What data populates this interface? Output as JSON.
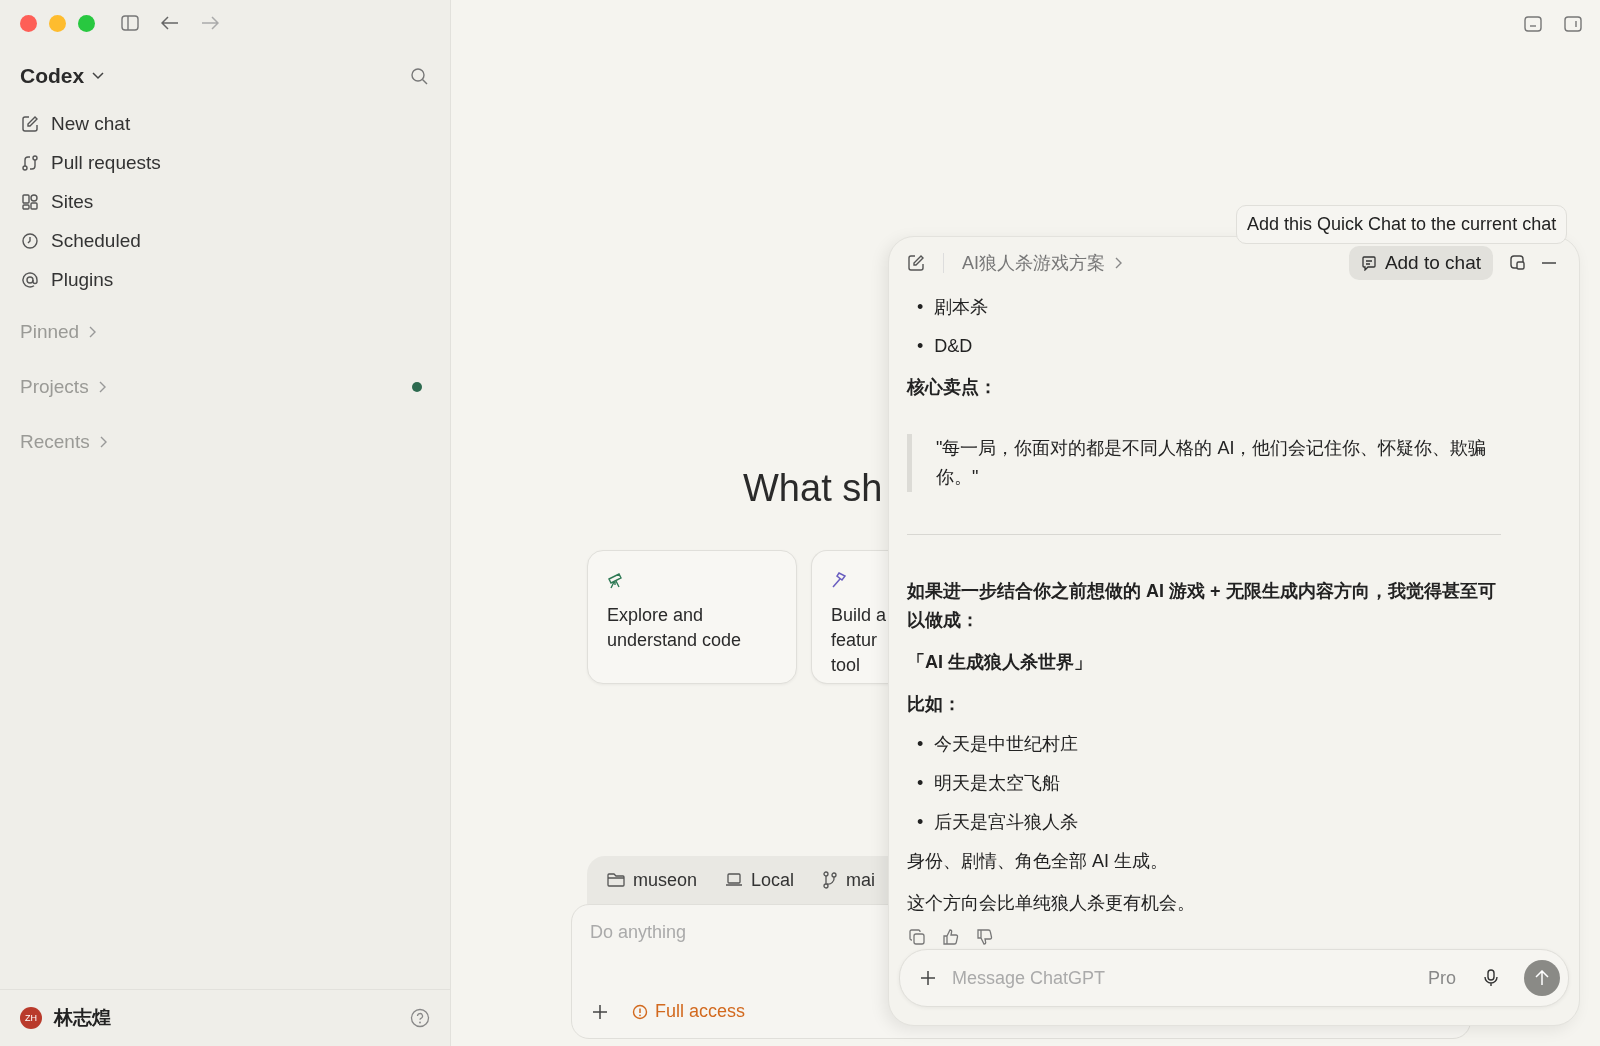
{
  "sidebar": {
    "workspace": "Codex",
    "nav": [
      {
        "label": "New chat"
      },
      {
        "label": "Pull requests"
      },
      {
        "label": "Sites"
      },
      {
        "label": "Scheduled"
      },
      {
        "label": "Plugins"
      }
    ],
    "sections": [
      {
        "label": "Pinned",
        "indicator": false
      },
      {
        "label": "Projects",
        "indicator": true
      },
      {
        "label": "Recents",
        "indicator": false
      }
    ],
    "user": {
      "initials": "ZH",
      "name": "林志煌"
    }
  },
  "main": {
    "heading": "What sh",
    "cards": [
      {
        "lines": [
          "Explore and",
          "understand code"
        ]
      },
      {
        "lines": [
          "Build a",
          "featur",
          "tool"
        ]
      }
    ],
    "context": [
      {
        "label": "museon"
      },
      {
        "label": "Local"
      },
      {
        "label": "mai"
      }
    ],
    "composer": {
      "placeholder": "Do anything",
      "access": "Full access"
    }
  },
  "quick_chat": {
    "tooltip": "Add this Quick Chat to the current chat",
    "title": "AI狼人杀游戏方案",
    "add_button": "Add to chat",
    "blocks": [
      {
        "kind": "list",
        "marker": "•",
        "items": [
          "剧本杀",
          "D&D"
        ]
      },
      {
        "kind": "heading",
        "text": "核心卖点："
      },
      {
        "kind": "quote",
        "text": "\"每一局，你面对的都是不同人格的 AI，他们会记住你、怀疑你、欺骗你。\""
      },
      {
        "kind": "rule"
      },
      {
        "kind": "heading",
        "text": "如果进一步结合你之前想做的 AI 游戏 + 无限生成内容方向，我觉得甚至可以做成："
      },
      {
        "kind": "heading",
        "text": "「AI 生成狼人杀世界」"
      },
      {
        "kind": "heading",
        "text": "比如："
      },
      {
        "kind": "list",
        "marker": "•",
        "items": [
          "今天是中世纪村庄",
          "明天是太空飞船",
          "后天是宫斗狼人杀"
        ]
      },
      {
        "kind": "paragraph",
        "text": "身份、剧情、角色全部 AI 生成。"
      },
      {
        "kind": "paragraph",
        "text": "这个方向会比单纯狼人杀更有机会。"
      }
    ],
    "composer": {
      "placeholder": "Message ChatGPT",
      "model": "Pro"
    }
  }
}
